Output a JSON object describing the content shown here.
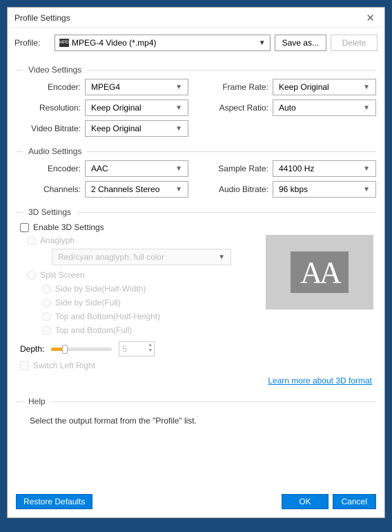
{
  "title": "Profile Settings",
  "profile": {
    "label": "Profile:",
    "value": "MPEG-4 Video (*.mp4)",
    "save_as": "Save as...",
    "delete": "Delete"
  },
  "sections": {
    "video": {
      "title": "Video Settings",
      "encoder_label": "Encoder:",
      "encoder_value": "MPEG4",
      "resolution_label": "Resolution:",
      "resolution_value": "Keep Original",
      "bitrate_label": "Video Bitrate:",
      "bitrate_value": "Keep Original",
      "framerate_label": "Frame Rate:",
      "framerate_value": "Keep Original",
      "aspect_label": "Aspect Ratio:",
      "aspect_value": "Auto"
    },
    "audio": {
      "title": "Audio Settings",
      "encoder_label": "Encoder:",
      "encoder_value": "AAC",
      "channels_label": "Channels:",
      "channels_value": "2 Channels Stereo",
      "samplerate_label": "Sample Rate:",
      "samplerate_value": "44100 Hz",
      "bitrate_label": "Audio Bitrate:",
      "bitrate_value": "96 kbps"
    },
    "three_d": {
      "title": "3D Settings",
      "enable_label": "Enable 3D Settings",
      "anaglyph_label": "Anaglyph",
      "anaglyph_value": "Red/cyan anaglyph, full color",
      "split_label": "Split Screen",
      "sbs_half": "Side by Side(Half-Width)",
      "sbs_full": "Side by Side(Full)",
      "tb_half": "Top and Bottom(Half-Height)",
      "tb_full": "Top and Bottom(Full)",
      "depth_label": "Depth:",
      "depth_value": "5",
      "switch_label": "Switch Left Right",
      "learn_more": "Learn more about 3D format",
      "preview_text": "AA"
    },
    "help": {
      "title": "Help",
      "body": "Select the output format from the \"Profile\" list."
    }
  },
  "footer": {
    "restore": "Restore Defaults",
    "ok": "OK",
    "cancel": "Cancel"
  }
}
